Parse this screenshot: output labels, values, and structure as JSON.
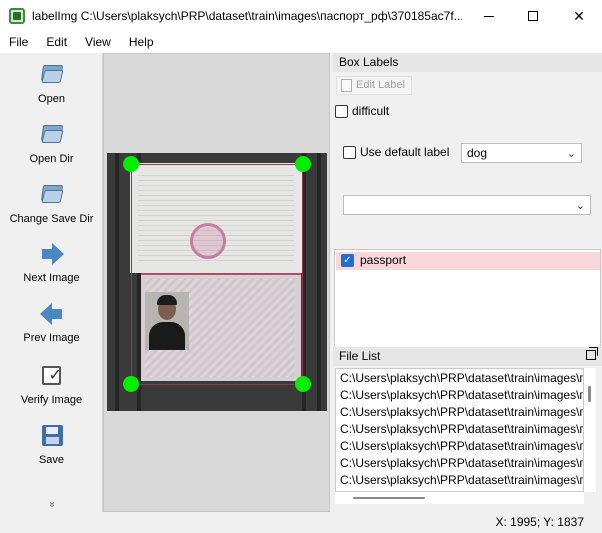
{
  "window": {
    "title": "labelImg C:\\Users\\plaksych\\PRP\\dataset\\train\\images\\паспорт_рф\\370185ac7f...",
    "minimize_icon": "minimize-icon",
    "maximize_icon": "maximize-icon",
    "close_glyph": "✕"
  },
  "menu": {
    "items": [
      "File",
      "Edit",
      "View",
      "Help"
    ]
  },
  "toolbar": {
    "items": [
      {
        "label": "Open",
        "icon": "open-folder-icon"
      },
      {
        "label": "Open Dir",
        "icon": "open-dir-icon"
      },
      {
        "label": "Change Save Dir",
        "icon": "change-save-dir-icon"
      },
      {
        "label": "Next Image",
        "icon": "next-image-icon"
      },
      {
        "label": "Prev Image",
        "icon": "prev-image-icon"
      },
      {
        "label": "Verify Image",
        "icon": "verify-image-icon"
      },
      {
        "label": "Save",
        "icon": "save-icon"
      }
    ],
    "more_glyph": "»"
  },
  "canvas": {
    "annotation": {
      "label": "passport",
      "handle_color": "#00ee00",
      "box_color": "#8b3a4a"
    }
  },
  "box_labels": {
    "title": "Box Labels",
    "edit_label_button": "Edit Label",
    "difficult_label": "difficult",
    "difficult_checked": false,
    "use_default_label": "Use default label",
    "use_default_checked": false,
    "default_label_value": "dog",
    "label_filter_value": "",
    "labels": [
      {
        "name": "passport",
        "checked": true,
        "color": "#f7d6dc"
      }
    ]
  },
  "file_list": {
    "title": "File List",
    "items": [
      "C:\\Users\\plaksych\\PRP\\dataset\\train\\images\\п",
      "C:\\Users\\plaksych\\PRP\\dataset\\train\\images\\п",
      "C:\\Users\\plaksych\\PRP\\dataset\\train\\images\\п",
      "C:\\Users\\plaksych\\PRP\\dataset\\train\\images\\п",
      "C:\\Users\\plaksych\\PRP\\dataset\\train\\images\\п",
      "C:\\Users\\plaksych\\PRP\\dataset\\train\\images\\п",
      "C:\\Users\\plaksych\\PRP\\dataset\\train\\images\\п"
    ]
  },
  "status": {
    "coords": "X: 1995; Y: 1837"
  }
}
